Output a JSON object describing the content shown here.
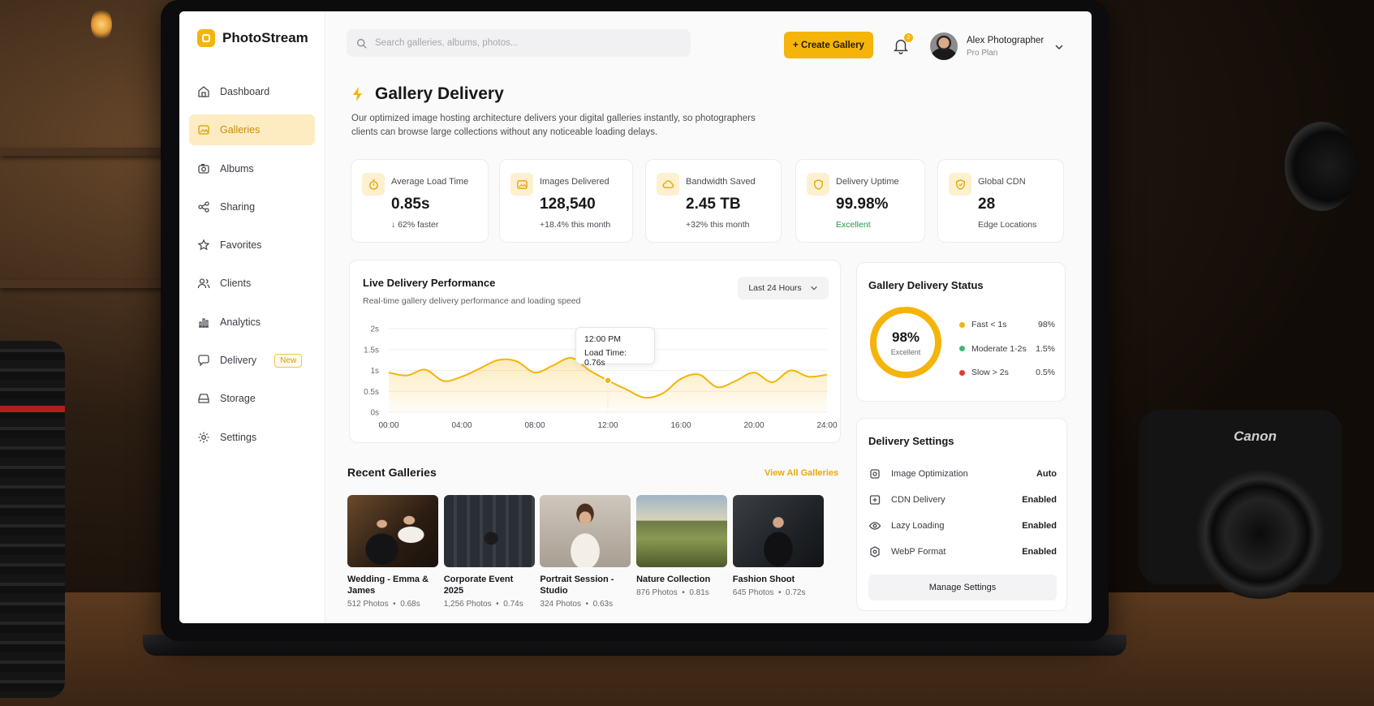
{
  "app": {
    "name": "PhotoStream"
  },
  "search": {
    "placeholder": "Search galleries, albums, photos..."
  },
  "header": {
    "create_label": "+ Create Gallery",
    "notification_count": "2",
    "user_name": "Alex Photographer",
    "user_plan": "Pro Plan"
  },
  "sidebar": {
    "items": [
      {
        "label": "Dashboard",
        "icon": "home-icon"
      },
      {
        "label": "Galleries",
        "icon": "gallery-icon",
        "active": true
      },
      {
        "label": "Albums",
        "icon": "camera-icon"
      },
      {
        "label": "Sharing",
        "icon": "share-icon"
      },
      {
        "label": "Favorites",
        "icon": "star-icon"
      },
      {
        "label": "Clients",
        "icon": "users-icon"
      },
      {
        "label": "Analytics",
        "icon": "bar-chart-icon"
      },
      {
        "label": "Delivery",
        "icon": "chat-icon",
        "badge": "New"
      },
      {
        "label": "Storage",
        "icon": "storage-icon"
      },
      {
        "label": "Settings",
        "icon": "gear-icon"
      }
    ]
  },
  "page": {
    "title": "Gallery Delivery",
    "description": "Our optimized image hosting architecture delivers your digital galleries instantly, so photographers clients can browse large collections without any noticeable loading delays."
  },
  "stats": [
    {
      "label": "Average Load Time",
      "value": "0.85s",
      "sub": "↓ 62% faster",
      "icon": "stopwatch-icon"
    },
    {
      "label": "Images Delivered",
      "value": "128,540",
      "sub": "+18.4% this month",
      "icon": "image-icon"
    },
    {
      "label": "Bandwidth Saved",
      "value": "2.45 TB",
      "sub": "+32% this month",
      "icon": "cloud-icon"
    },
    {
      "label": "Delivery Uptime",
      "value": "99.98%",
      "sub": "Excellent",
      "icon": "shield-icon"
    },
    {
      "label": "Global CDN",
      "value": "28",
      "sub": "Edge Locations",
      "icon": "globe-shield-icon"
    }
  ],
  "performance": {
    "title": "Live Delivery Performance",
    "subtitle": "Real-time gallery delivery performance and loading speed",
    "range": "Last 24 Hours",
    "tooltip_time": "12:00 PM",
    "tooltip_value": "Load Time: 0.76s"
  },
  "chart_data": {
    "type": "area",
    "title": "Live Delivery Performance",
    "x": [
      "00:00",
      "01:00",
      "02:00",
      "03:00",
      "04:00",
      "05:00",
      "06:00",
      "07:00",
      "08:00",
      "09:00",
      "10:00",
      "11:00",
      "12:00",
      "13:00",
      "14:00",
      "15:00",
      "16:00",
      "17:00",
      "18:00",
      "19:00",
      "20:00",
      "21:00",
      "22:00",
      "23:00",
      "24:00"
    ],
    "x_ticks": [
      "00:00",
      "04:00",
      "08:00",
      "12:00",
      "16:00",
      "20:00",
      "24:00"
    ],
    "y_ticks": [
      "0s",
      "0.5s",
      "1s",
      "1.5s",
      "2s"
    ],
    "ylim": [
      0,
      2
    ],
    "values": [
      0.95,
      0.88,
      1.02,
      0.75,
      0.85,
      1.05,
      1.25,
      1.22,
      0.95,
      1.12,
      1.3,
      1.0,
      0.76,
      0.55,
      0.35,
      0.45,
      0.8,
      0.9,
      0.6,
      0.75,
      0.95,
      0.72,
      1.0,
      0.85,
      0.9
    ],
    "highlight": {
      "x": "12:00",
      "value": 0.76
    },
    "color": "#f5b40a"
  },
  "status": {
    "title": "Gallery Delivery Status",
    "donut_value": "98%",
    "donut_label": "Excellent",
    "donut_fraction": 0.98,
    "legend": [
      {
        "label": "Fast < 1s",
        "value": "98%",
        "color": "#f5b40a"
      },
      {
        "label": "Moderate 1-2s",
        "value": "1.5%",
        "color": "#3fb97a"
      },
      {
        "label": "Slow > 2s",
        "value": "0.5%",
        "color": "#e53935"
      }
    ]
  },
  "settings": {
    "title": "Delivery Settings",
    "rows": [
      {
        "label": "Image Optimization",
        "value": "Auto",
        "icon": "optimize-icon"
      },
      {
        "label": "CDN Delivery",
        "value": "Enabled",
        "icon": "cdn-icon"
      },
      {
        "label": "Lazy Loading",
        "value": "Enabled",
        "icon": "eye-icon"
      },
      {
        "label": "WebP Format",
        "value": "Enabled",
        "icon": "format-icon"
      }
    ],
    "manage_label": "Manage Settings"
  },
  "recent": {
    "title": "Recent Galleries",
    "view_all": "View All Galleries",
    "items": [
      {
        "name": "Wedding - Emma & James",
        "photos": "512 Photos",
        "time": "0.68s"
      },
      {
        "name": "Corporate Event 2025",
        "photos": "1,256 Photos",
        "time": "0.74s"
      },
      {
        "name": "Portrait Session - Studio",
        "photos": "324 Photos",
        "time": "0.63s"
      },
      {
        "name": "Nature Collection",
        "photos": "876 Photos",
        "time": "0.81s"
      },
      {
        "name": "Fashion Shoot",
        "photos": "645 Photos",
        "time": "0.72s"
      }
    ]
  },
  "colors": {
    "accent": "#f5b40a",
    "accent_soft": "#fdecc2",
    "success": "#1f9a46"
  }
}
